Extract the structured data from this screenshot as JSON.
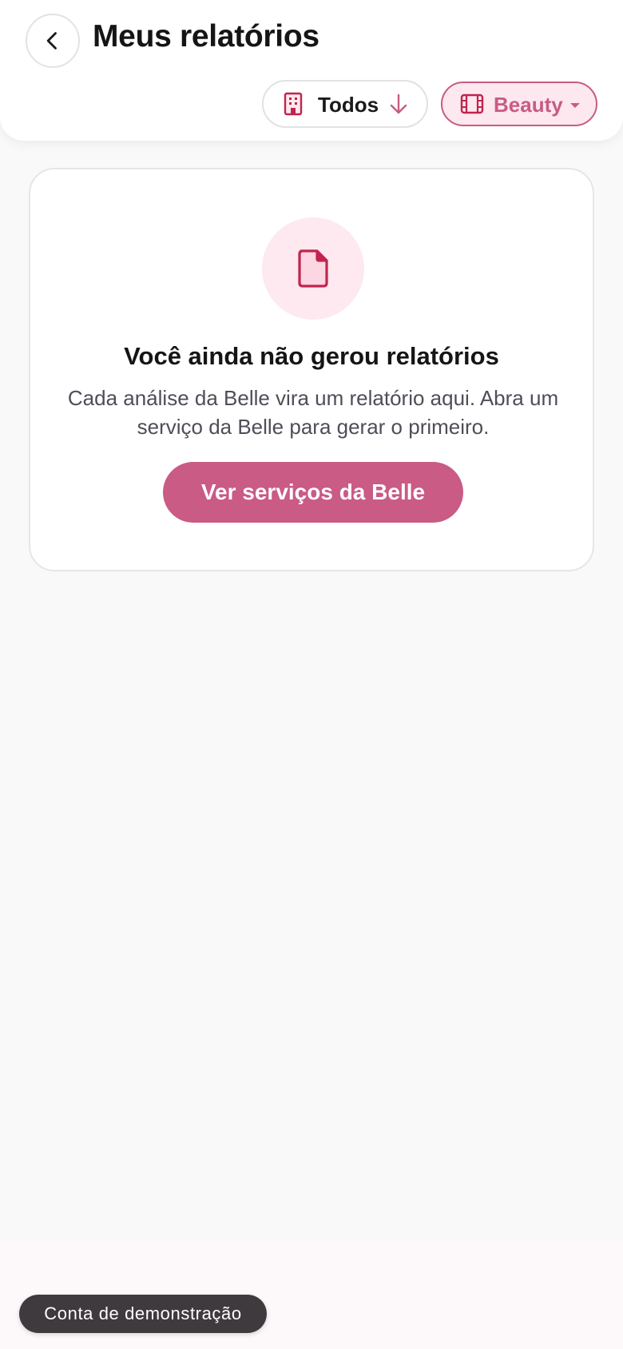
{
  "header": {
    "title": "Meus relatórios",
    "back_icon": "chevron-left-icon"
  },
  "filters": {
    "scope": {
      "label": "Todos",
      "icon": "building-icon",
      "sort_icon": "arrow-down-icon"
    },
    "category": {
      "label": "Beauty",
      "icon": "film-icon",
      "dropdown_icon": "caret-down-icon"
    }
  },
  "empty_state": {
    "icon": "document-icon",
    "title": "Você ainda não gerou relatórios",
    "description": "Cada análise da Belle vira um relatório aqui. Abra um serviço da Belle para gerar o primeiro.",
    "cta_label": "Ver serviços da Belle"
  },
  "badge": {
    "label": "Conta de demonstração"
  },
  "colors": {
    "accent": "#c95b84",
    "accent_dark": "#c0244f",
    "accent_soft": "#fde9ef",
    "background": "#f9f9f9",
    "badge_bg": "#3f3a3d"
  }
}
